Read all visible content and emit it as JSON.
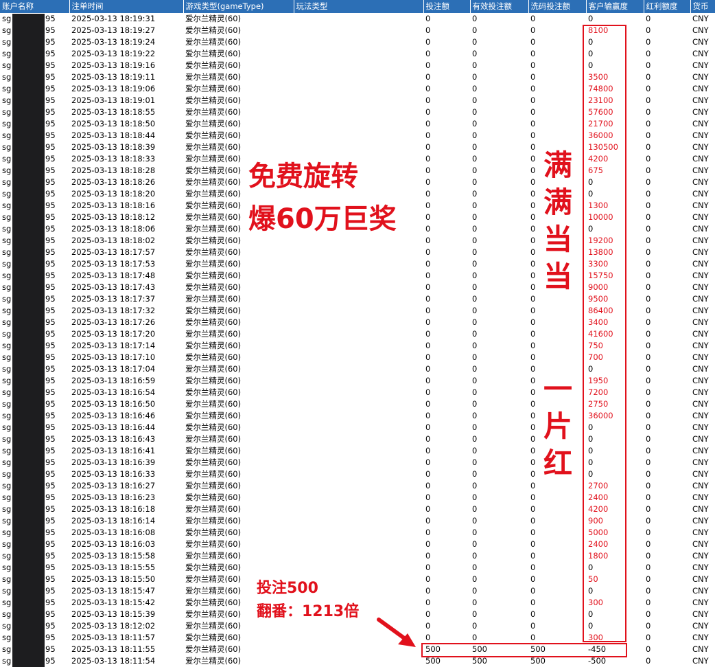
{
  "headers": [
    "账户名称",
    "注单时间",
    "游戏类型(gameType)",
    "玩法类型",
    "投注额",
    "有效投注额",
    "洗码投注额",
    "客户输赢度",
    "红利额度",
    "货币"
  ],
  "account_prefix": "sg",
  "account_suffix": "95",
  "rows": [
    {
      "time": "2025-03-13 18:19:31",
      "game": "爱尔兰精灵(60)",
      "bet": "0",
      "valid": "0",
      "wash": "0",
      "winloss": "0",
      "bonus": "0",
      "currency": "CNY"
    },
    {
      "time": "2025-03-13 18:19:27",
      "game": "爱尔兰精灵(60)",
      "bet": "0",
      "valid": "0",
      "wash": "0",
      "winloss": "8100",
      "bonus": "0",
      "currency": "CNY"
    },
    {
      "time": "2025-03-13 18:19:24",
      "game": "爱尔兰精灵(60)",
      "bet": "0",
      "valid": "0",
      "wash": "0",
      "winloss": "0",
      "bonus": "0",
      "currency": "CNY"
    },
    {
      "time": "2025-03-13 18:19:22",
      "game": "爱尔兰精灵(60)",
      "bet": "0",
      "valid": "0",
      "wash": "0",
      "winloss": "0",
      "bonus": "0",
      "currency": "CNY"
    },
    {
      "time": "2025-03-13 18:19:16",
      "game": "爱尔兰精灵(60)",
      "bet": "0",
      "valid": "0",
      "wash": "0",
      "winloss": "0",
      "bonus": "0",
      "currency": "CNY"
    },
    {
      "time": "2025-03-13 18:19:11",
      "game": "爱尔兰精灵(60)",
      "bet": "0",
      "valid": "0",
      "wash": "0",
      "winloss": "3500",
      "bonus": "0",
      "currency": "CNY"
    },
    {
      "time": "2025-03-13 18:19:06",
      "game": "爱尔兰精灵(60)",
      "bet": "0",
      "valid": "0",
      "wash": "0",
      "winloss": "74800",
      "bonus": "0",
      "currency": "CNY"
    },
    {
      "time": "2025-03-13 18:19:01",
      "game": "爱尔兰精灵(60)",
      "bet": "0",
      "valid": "0",
      "wash": "0",
      "winloss": "23100",
      "bonus": "0",
      "currency": "CNY"
    },
    {
      "time": "2025-03-13 18:18:55",
      "game": "爱尔兰精灵(60)",
      "bet": "0",
      "valid": "0",
      "wash": "0",
      "winloss": "57600",
      "bonus": "0",
      "currency": "CNY"
    },
    {
      "time": "2025-03-13 18:18:50",
      "game": "爱尔兰精灵(60)",
      "bet": "0",
      "valid": "0",
      "wash": "0",
      "winloss": "21700",
      "bonus": "0",
      "currency": "CNY"
    },
    {
      "time": "2025-03-13 18:18:44",
      "game": "爱尔兰精灵(60)",
      "bet": "0",
      "valid": "0",
      "wash": "0",
      "winloss": "36000",
      "bonus": "0",
      "currency": "CNY"
    },
    {
      "time": "2025-03-13 18:18:39",
      "game": "爱尔兰精灵(60)",
      "bet": "0",
      "valid": "0",
      "wash": "0",
      "winloss": "130500",
      "bonus": "0",
      "currency": "CNY"
    },
    {
      "time": "2025-03-13 18:18:33",
      "game": "爱尔兰精灵(60)",
      "bet": "0",
      "valid": "0",
      "wash": "0",
      "winloss": "4200",
      "bonus": "0",
      "currency": "CNY"
    },
    {
      "time": "2025-03-13 18:18:28",
      "game": "爱尔兰精灵(60)",
      "bet": "0",
      "valid": "0",
      "wash": "0",
      "winloss": "675",
      "bonus": "0",
      "currency": "CNY"
    },
    {
      "time": "2025-03-13 18:18:26",
      "game": "爱尔兰精灵(60)",
      "bet": "0",
      "valid": "0",
      "wash": "0",
      "winloss": "0",
      "bonus": "0",
      "currency": "CNY"
    },
    {
      "time": "2025-03-13 18:18:20",
      "game": "爱尔兰精灵(60)",
      "bet": "0",
      "valid": "0",
      "wash": "0",
      "winloss": "0",
      "bonus": "0",
      "currency": "CNY"
    },
    {
      "time": "2025-03-13 18:18:16",
      "game": "爱尔兰精灵(60)",
      "bet": "0",
      "valid": "0",
      "wash": "0",
      "winloss": "1300",
      "bonus": "0",
      "currency": "CNY"
    },
    {
      "time": "2025-03-13 18:18:12",
      "game": "爱尔兰精灵(60)",
      "bet": "0",
      "valid": "0",
      "wash": "0",
      "winloss": "10000",
      "bonus": "0",
      "currency": "CNY"
    },
    {
      "time": "2025-03-13 18:18:06",
      "game": "爱尔兰精灵(60)",
      "bet": "0",
      "valid": "0",
      "wash": "0",
      "winloss": "0",
      "bonus": "0",
      "currency": "CNY"
    },
    {
      "time": "2025-03-13 18:18:02",
      "game": "爱尔兰精灵(60)",
      "bet": "0",
      "valid": "0",
      "wash": "0",
      "winloss": "19200",
      "bonus": "0",
      "currency": "CNY"
    },
    {
      "time": "2025-03-13 18:17:57",
      "game": "爱尔兰精灵(60)",
      "bet": "0",
      "valid": "0",
      "wash": "0",
      "winloss": "13800",
      "bonus": "0",
      "currency": "CNY"
    },
    {
      "time": "2025-03-13 18:17:53",
      "game": "爱尔兰精灵(60)",
      "bet": "0",
      "valid": "0",
      "wash": "0",
      "winloss": "3300",
      "bonus": "0",
      "currency": "CNY"
    },
    {
      "time": "2025-03-13 18:17:48",
      "game": "爱尔兰精灵(60)",
      "bet": "0",
      "valid": "0",
      "wash": "0",
      "winloss": "15750",
      "bonus": "0",
      "currency": "CNY"
    },
    {
      "time": "2025-03-13 18:17:43",
      "game": "爱尔兰精灵(60)",
      "bet": "0",
      "valid": "0",
      "wash": "0",
      "winloss": "9000",
      "bonus": "0",
      "currency": "CNY"
    },
    {
      "time": "2025-03-13 18:17:37",
      "game": "爱尔兰精灵(60)",
      "bet": "0",
      "valid": "0",
      "wash": "0",
      "winloss": "9500",
      "bonus": "0",
      "currency": "CNY"
    },
    {
      "time": "2025-03-13 18:17:32",
      "game": "爱尔兰精灵(60)",
      "bet": "0",
      "valid": "0",
      "wash": "0",
      "winloss": "86400",
      "bonus": "0",
      "currency": "CNY"
    },
    {
      "time": "2025-03-13 18:17:26",
      "game": "爱尔兰精灵(60)",
      "bet": "0",
      "valid": "0",
      "wash": "0",
      "winloss": "3400",
      "bonus": "0",
      "currency": "CNY"
    },
    {
      "time": "2025-03-13 18:17:20",
      "game": "爱尔兰精灵(60)",
      "bet": "0",
      "valid": "0",
      "wash": "0",
      "winloss": "41600",
      "bonus": "0",
      "currency": "CNY"
    },
    {
      "time": "2025-03-13 18:17:14",
      "game": "爱尔兰精灵(60)",
      "bet": "0",
      "valid": "0",
      "wash": "0",
      "winloss": "750",
      "bonus": "0",
      "currency": "CNY"
    },
    {
      "time": "2025-03-13 18:17:10",
      "game": "爱尔兰精灵(60)",
      "bet": "0",
      "valid": "0",
      "wash": "0",
      "winloss": "700",
      "bonus": "0",
      "currency": "CNY"
    },
    {
      "time": "2025-03-13 18:17:04",
      "game": "爱尔兰精灵(60)",
      "bet": "0",
      "valid": "0",
      "wash": "0",
      "winloss": "0",
      "bonus": "0",
      "currency": "CNY"
    },
    {
      "time": "2025-03-13 18:16:59",
      "game": "爱尔兰精灵(60)",
      "bet": "0",
      "valid": "0",
      "wash": "0",
      "winloss": "1950",
      "bonus": "0",
      "currency": "CNY"
    },
    {
      "time": "2025-03-13 18:16:54",
      "game": "爱尔兰精灵(60)",
      "bet": "0",
      "valid": "0",
      "wash": "0",
      "winloss": "7200",
      "bonus": "0",
      "currency": "CNY"
    },
    {
      "time": "2025-03-13 18:16:50",
      "game": "爱尔兰精灵(60)",
      "bet": "0",
      "valid": "0",
      "wash": "0",
      "winloss": "2750",
      "bonus": "0",
      "currency": "CNY"
    },
    {
      "time": "2025-03-13 18:16:46",
      "game": "爱尔兰精灵(60)",
      "bet": "0",
      "valid": "0",
      "wash": "0",
      "winloss": "36000",
      "bonus": "0",
      "currency": "CNY"
    },
    {
      "time": "2025-03-13 18:16:44",
      "game": "爱尔兰精灵(60)",
      "bet": "0",
      "valid": "0",
      "wash": "0",
      "winloss": "0",
      "bonus": "0",
      "currency": "CNY"
    },
    {
      "time": "2025-03-13 18:16:43",
      "game": "爱尔兰精灵(60)",
      "bet": "0",
      "valid": "0",
      "wash": "0",
      "winloss": "0",
      "bonus": "0",
      "currency": "CNY"
    },
    {
      "time": "2025-03-13 18:16:41",
      "game": "爱尔兰精灵(60)",
      "bet": "0",
      "valid": "0",
      "wash": "0",
      "winloss": "0",
      "bonus": "0",
      "currency": "CNY"
    },
    {
      "time": "2025-03-13 18:16:39",
      "game": "爱尔兰精灵(60)",
      "bet": "0",
      "valid": "0",
      "wash": "0",
      "winloss": "0",
      "bonus": "0",
      "currency": "CNY"
    },
    {
      "time": "2025-03-13 18:16:33",
      "game": "爱尔兰精灵(60)",
      "bet": "0",
      "valid": "0",
      "wash": "0",
      "winloss": "0",
      "bonus": "0",
      "currency": "CNY"
    },
    {
      "time": "2025-03-13 18:16:27",
      "game": "爱尔兰精灵(60)",
      "bet": "0",
      "valid": "0",
      "wash": "0",
      "winloss": "2700",
      "bonus": "0",
      "currency": "CNY"
    },
    {
      "time": "2025-03-13 18:16:23",
      "game": "爱尔兰精灵(60)",
      "bet": "0",
      "valid": "0",
      "wash": "0",
      "winloss": "2400",
      "bonus": "0",
      "currency": "CNY"
    },
    {
      "time": "2025-03-13 18:16:18",
      "game": "爱尔兰精灵(60)",
      "bet": "0",
      "valid": "0",
      "wash": "0",
      "winloss": "4200",
      "bonus": "0",
      "currency": "CNY"
    },
    {
      "time": "2025-03-13 18:16:14",
      "game": "爱尔兰精灵(60)",
      "bet": "0",
      "valid": "0",
      "wash": "0",
      "winloss": "900",
      "bonus": "0",
      "currency": "CNY"
    },
    {
      "time": "2025-03-13 18:16:08",
      "game": "爱尔兰精灵(60)",
      "bet": "0",
      "valid": "0",
      "wash": "0",
      "winloss": "5000",
      "bonus": "0",
      "currency": "CNY"
    },
    {
      "time": "2025-03-13 18:16:03",
      "game": "爱尔兰精灵(60)",
      "bet": "0",
      "valid": "0",
      "wash": "0",
      "winloss": "2400",
      "bonus": "0",
      "currency": "CNY"
    },
    {
      "time": "2025-03-13 18:15:58",
      "game": "爱尔兰精灵(60)",
      "bet": "0",
      "valid": "0",
      "wash": "0",
      "winloss": "1800",
      "bonus": "0",
      "currency": "CNY"
    },
    {
      "time": "2025-03-13 18:15:55",
      "game": "爱尔兰精灵(60)",
      "bet": "0",
      "valid": "0",
      "wash": "0",
      "winloss": "0",
      "bonus": "0",
      "currency": "CNY"
    },
    {
      "time": "2025-03-13 18:15:50",
      "game": "爱尔兰精灵(60)",
      "bet": "0",
      "valid": "0",
      "wash": "0",
      "winloss": "50",
      "bonus": "0",
      "currency": "CNY"
    },
    {
      "time": "2025-03-13 18:15:47",
      "game": "爱尔兰精灵(60)",
      "bet": "0",
      "valid": "0",
      "wash": "0",
      "winloss": "0",
      "bonus": "0",
      "currency": "CNY"
    },
    {
      "time": "2025-03-13 18:15:42",
      "game": "爱尔兰精灵(60)",
      "bet": "0",
      "valid": "0",
      "wash": "0",
      "winloss": "300",
      "bonus": "0",
      "currency": "CNY"
    },
    {
      "time": "2025-03-13 18:15:39",
      "game": "爱尔兰精灵(60)",
      "bet": "0",
      "valid": "0",
      "wash": "0",
      "winloss": "0",
      "bonus": "0",
      "currency": "CNY"
    },
    {
      "time": "2025-03-13 18:12:02",
      "game": "爱尔兰精灵(60)",
      "bet": "0",
      "valid": "0",
      "wash": "0",
      "winloss": "0",
      "bonus": "0",
      "currency": "CNY"
    },
    {
      "time": "2025-03-13 18:11:57",
      "game": "爱尔兰精灵(60)",
      "bet": "0",
      "valid": "0",
      "wash": "0",
      "winloss": "300",
      "bonus": "0",
      "currency": "CNY"
    },
    {
      "time": "2025-03-13 18:11:55",
      "game": "爱尔兰精灵(60)",
      "bet": "500",
      "valid": "500",
      "wash": "500",
      "winloss": "-450",
      "bonus": "0",
      "currency": "CNY"
    },
    {
      "time": "2025-03-13 18:11:54",
      "game": "爱尔兰精灵(60)",
      "bet": "500",
      "valid": "500",
      "wash": "500",
      "winloss": "-500",
      "bonus": "0",
      "currency": "CNY"
    }
  ],
  "annotations": {
    "headline_line1": "免费旋转",
    "headline_line2": "爆60万巨奖",
    "vertical_1": "满满当当",
    "vertical_2": "一片红",
    "note_line1": "投注500",
    "note_line2": "翻番：1213倍"
  },
  "colors": {
    "header_bg": "#2c6fb6",
    "highlight_red": "#e1111c",
    "redaction": "#1d1d1f"
  }
}
